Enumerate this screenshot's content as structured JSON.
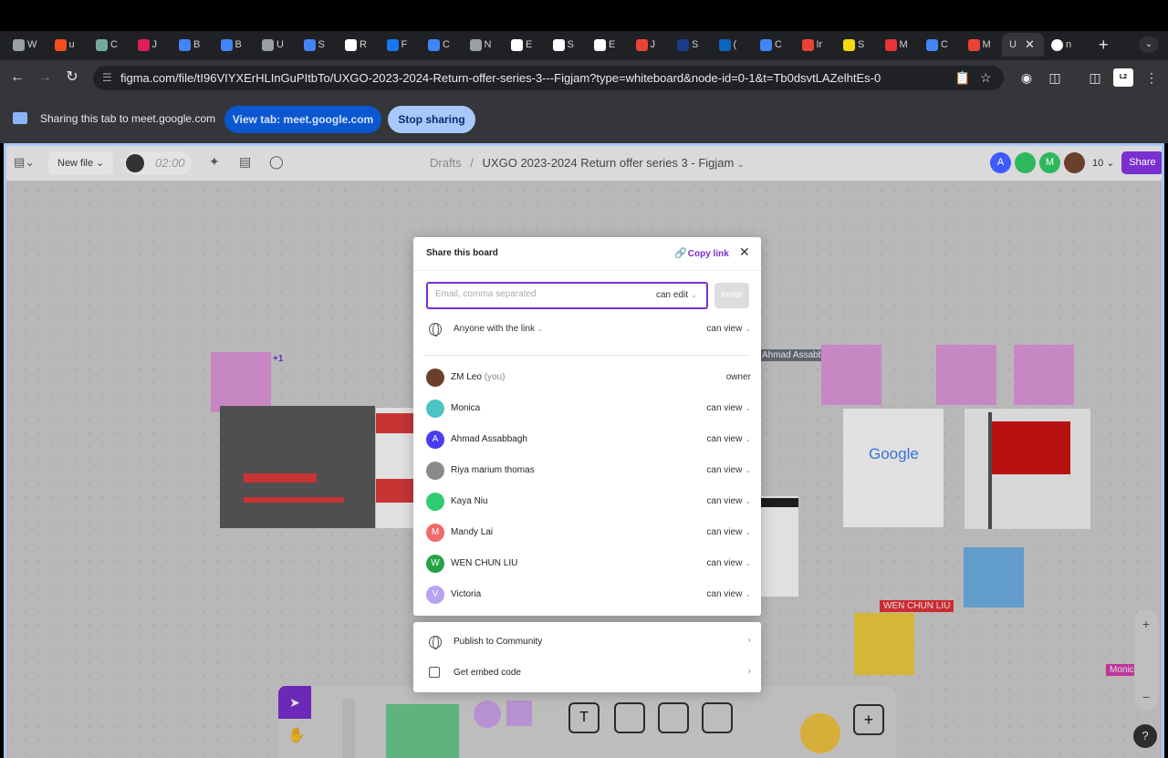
{
  "browser": {
    "tabs": [
      {
        "letter": "W",
        "color": "#9aa0a6"
      },
      {
        "letter": "u",
        "color": "#f24e1e"
      },
      {
        "letter": "C",
        "color": "#74aa9c"
      },
      {
        "letter": "J",
        "color": "#e01e5a"
      },
      {
        "letter": "B",
        "color": "#4285f4"
      },
      {
        "letter": "B",
        "color": "#4285f4"
      },
      {
        "letter": "U",
        "color": "#9aa0a6"
      },
      {
        "letter": "S",
        "color": "#4285f4"
      },
      {
        "letter": "R",
        "color": "#ffffff"
      },
      {
        "letter": "F",
        "color": "#1877f2"
      },
      {
        "letter": "C",
        "color": "#4285f4"
      },
      {
        "letter": "N",
        "color": "#9aa0a6"
      },
      {
        "letter": "E",
        "color": "#ffffff"
      },
      {
        "letter": "S",
        "color": "#ffffff"
      },
      {
        "letter": "E",
        "color": "#ffffff"
      },
      {
        "letter": "J",
        "color": "#ea4335"
      },
      {
        "letter": "S",
        "color": "#1a3c8c"
      },
      {
        "letter": "(",
        "color": "#0a66c2"
      },
      {
        "letter": "C",
        "color": "#4285f4"
      },
      {
        "letter": "Ir",
        "color": "#ea4335"
      },
      {
        "letter": "S",
        "color": "#f5d90a"
      },
      {
        "letter": "M",
        "color": "#e8333a"
      },
      {
        "letter": "C",
        "color": "#4285f4"
      },
      {
        "letter": "M",
        "color": "#ea4335"
      }
    ],
    "active_tab_letter": "U",
    "last_tab_letter": "n",
    "url": "figma.com/file/tI96VIYXErHLInGuPItbTo/UXGO-2023-2024-Return-offer-series-3---Figjam?type=whiteboard&node-id=0-1&t=Tb0dsvtLAZelhtEs-0",
    "profile_label": "L2"
  },
  "sharing_bar": {
    "message": "Sharing this tab to meet.google.com",
    "view_tab_label": "View tab: meet.google.com",
    "stop_label": "Stop sharing"
  },
  "figjam": {
    "new_file_label": "New file",
    "timer": "02:00",
    "breadcrumb_parent": "Drafts",
    "breadcrumb_sep": "/",
    "file_title": "UXGO 2023-2024 Return offer series 3 - Figjam",
    "avatars": [
      {
        "initial": "A",
        "color": "#3d5afe"
      },
      {
        "initial": "",
        "color": "#2eb85c"
      },
      {
        "initial": "M",
        "color": "#2eb85c"
      },
      {
        "initial": "",
        "color": "#6b3f2a"
      }
    ],
    "collaborator_count": "10",
    "share_label": "Share",
    "canvas_labels": {
      "ahmad_tag": "Ahmad Assabbagh",
      "wen_tag": "WEN CHUN LIU",
      "monica_tag": "Monic",
      "google_logo": "Google"
    }
  },
  "share_modal": {
    "title": "Share this board",
    "copy_link_label": "Copy link",
    "email_placeholder": "Email, comma separated",
    "invite_permission": "can edit",
    "invite_label": "Invite",
    "link_access_label": "Anyone with the link",
    "link_access_permission": "can view",
    "people": [
      {
        "name": "ZM Leo",
        "suffix": "(you)",
        "permission": "owner",
        "initial": "",
        "color": "#6b3f2a",
        "has_menu": false
      },
      {
        "name": "Monica",
        "suffix": "",
        "permission": "can view",
        "initial": "",
        "color": "#4cc4c4",
        "has_menu": true
      },
      {
        "name": "Ahmad Assabbagh",
        "suffix": "",
        "permission": "can view",
        "initial": "A",
        "color": "#4a3df0",
        "has_menu": true
      },
      {
        "name": "Riya marium thomas",
        "suffix": "",
        "permission": "can view",
        "initial": "",
        "color": "#8a8a8a",
        "has_menu": true
      },
      {
        "name": "Kaya Niu",
        "suffix": "",
        "permission": "can view",
        "initial": "",
        "color": "#2ecc71",
        "has_menu": true
      },
      {
        "name": "Mandy Lai",
        "suffix": "",
        "permission": "can view",
        "initial": "M",
        "color": "#f06a6a",
        "has_menu": true
      },
      {
        "name": "WEN CHUN LIU",
        "suffix": "",
        "permission": "can view",
        "initial": "W",
        "color": "#25a244",
        "has_menu": true
      },
      {
        "name": "Victoria",
        "suffix": "",
        "permission": "can view",
        "initial": "V",
        "color": "#b9a2f0",
        "has_menu": true
      }
    ],
    "publish_label": "Publish to Community",
    "embed_label": "Get embed code"
  }
}
